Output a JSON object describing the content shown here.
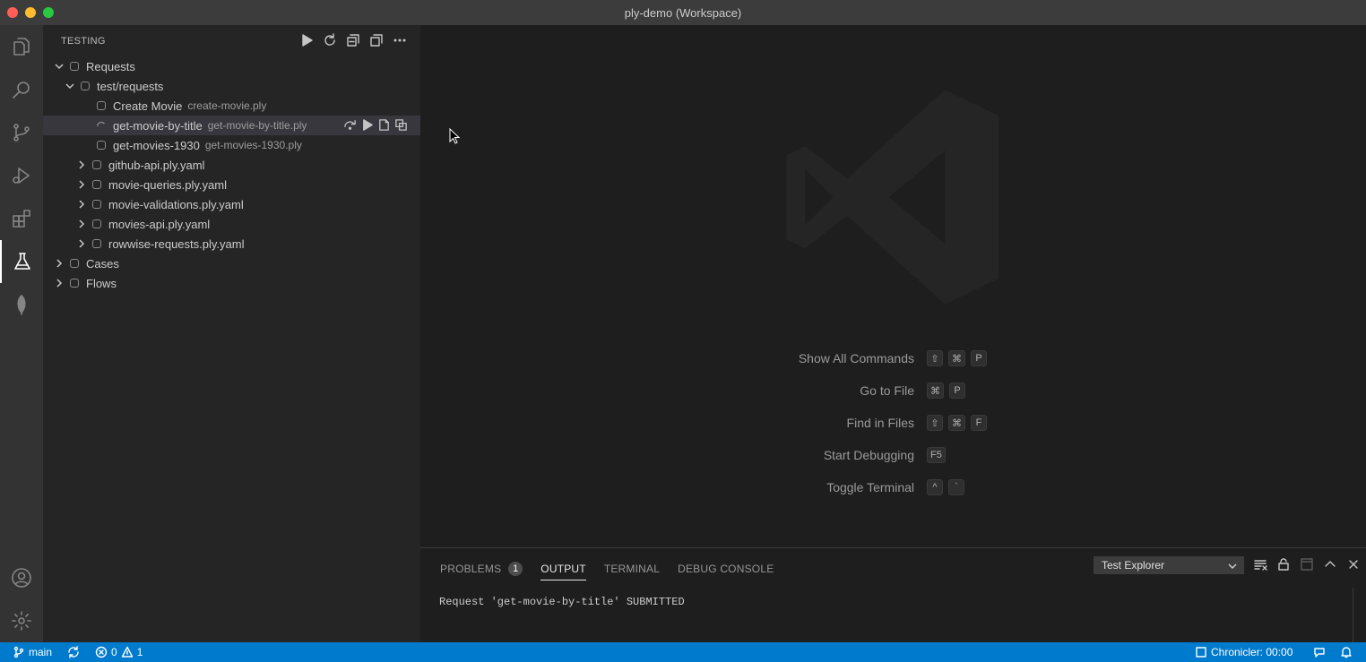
{
  "window": {
    "title": "ply-demo (Workspace)"
  },
  "sidebar": {
    "title": "TESTING",
    "tree": [
      {
        "label": "Requests",
        "desc": "",
        "level": 0,
        "expanded": true
      },
      {
        "label": "test/requests",
        "desc": "",
        "level": 1,
        "expanded": true
      },
      {
        "label": "Create Movie",
        "desc": "create-movie.ply",
        "level": 2
      },
      {
        "label": "get-movie-by-title",
        "desc": "get-movie-by-title.ply",
        "level": 2,
        "selected": true
      },
      {
        "label": "get-movies-1930",
        "desc": "get-movies-1930.ply",
        "level": 2
      },
      {
        "label": "github-api.ply.yaml",
        "desc": "",
        "level": 2,
        "collapsed": true
      },
      {
        "label": "movie-queries.ply.yaml",
        "desc": "",
        "level": 2,
        "collapsed": true
      },
      {
        "label": "movie-validations.ply.yaml",
        "desc": "",
        "level": 2,
        "collapsed": true
      },
      {
        "label": "movies-api.ply.yaml",
        "desc": "",
        "level": 2,
        "collapsed": true
      },
      {
        "label": "rowwise-requests.ply.yaml",
        "desc": "",
        "level": 2,
        "collapsed": true
      },
      {
        "label": "Cases",
        "desc": "",
        "level": 0,
        "collapsed": true
      },
      {
        "label": "Flows",
        "desc": "",
        "level": 0,
        "collapsed": true
      }
    ]
  },
  "editor": {
    "hints": [
      {
        "label": "Show All Commands",
        "keys": [
          "⇧",
          "⌘",
          "P"
        ]
      },
      {
        "label": "Go to File",
        "keys": [
          "⌘",
          "P"
        ]
      },
      {
        "label": "Find in Files",
        "keys": [
          "⇧",
          "⌘",
          "F"
        ]
      },
      {
        "label": "Start Debugging",
        "keys": [
          "F5"
        ]
      },
      {
        "label": "Toggle Terminal",
        "keys": [
          "^",
          "`"
        ]
      }
    ]
  },
  "panel": {
    "tabs": [
      {
        "label": "PROBLEMS",
        "badge": "1"
      },
      {
        "label": "OUTPUT",
        "active": true
      },
      {
        "label": "TERMINAL"
      },
      {
        "label": "DEBUG CONSOLE"
      }
    ],
    "channel": "Test Explorer",
    "output": "Request 'get-movie-by-title' SUBMITTED"
  },
  "statusbar": {
    "branch": "main",
    "errors": "0",
    "warnings": "1",
    "chronicler": "Chronicler: 00:00"
  },
  "colors": {
    "accent": "#007acc",
    "sidebar": "#252526",
    "activity": "#333333"
  }
}
